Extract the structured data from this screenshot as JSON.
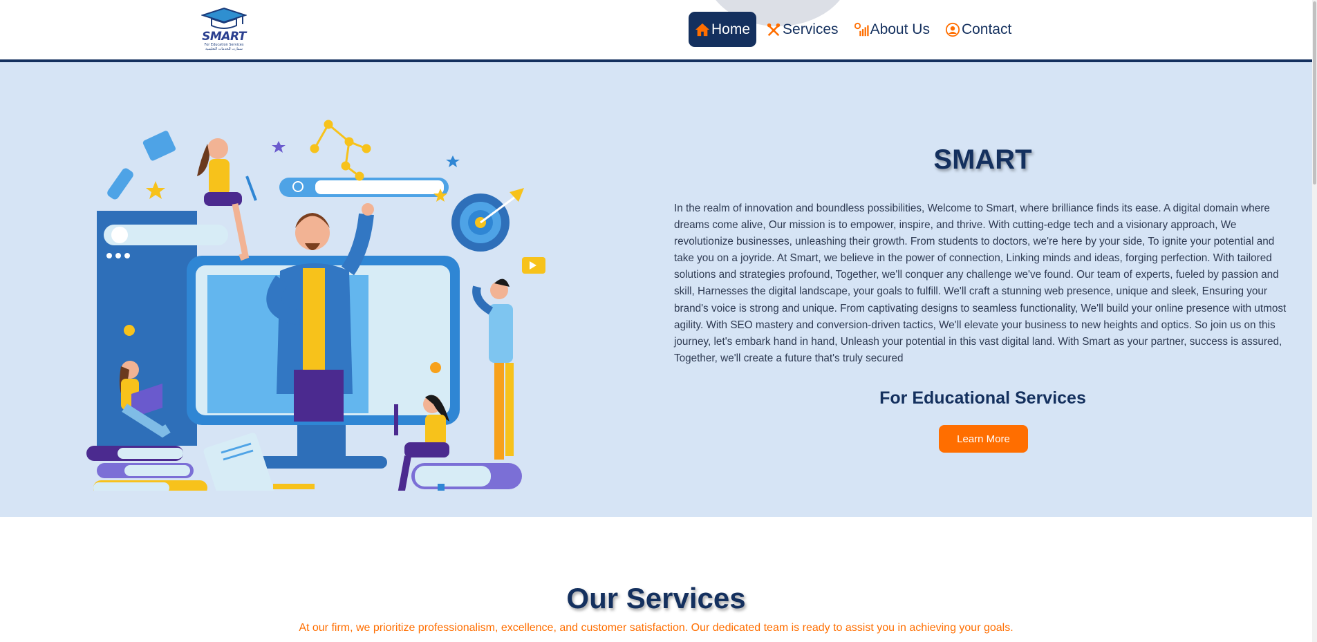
{
  "brand": {
    "logo_text": "SMART",
    "logo_sub_en": "For Education Services",
    "logo_sub_ar": "سمارت للخدمات التعليمية",
    "primary_color": "#14305e",
    "accent_color": "#ff6e00",
    "hero_bg": "#d6e4f5"
  },
  "nav": {
    "items": [
      {
        "label": "Home",
        "icon": "home-icon",
        "active": true
      },
      {
        "label": "Services",
        "icon": "tools-icon",
        "active": false
      },
      {
        "label": "About Us",
        "icon": "chart-icon",
        "active": false
      },
      {
        "label": "Contact",
        "icon": "contact-icon",
        "active": false
      }
    ]
  },
  "hero": {
    "title": "SMART",
    "paragraph": "In the realm of innovation and boundless possibilities, Welcome to Smart, where brilliance finds its ease. A digital domain where dreams come alive, Our mission is to empower, inspire, and thrive. With cutting-edge tech and a visionary approach, We revolutionize businesses, unleashing their growth. From students to doctors, we're here by your side, To ignite your potential and take you on a joyride. At Smart, we believe in the power of connection, Linking minds and ideas, forging perfection. With tailored solutions and strategies profound, Together, we'll conquer any challenge we've found. Our team of experts, fueled by passion and skill, Harnesses the digital landscape, your goals to fulfill. We'll craft a stunning web presence, unique and sleek, Ensuring your brand's voice is strong and unique. From captivating designs to seamless functionality, We'll build your online presence with utmost agility. With SEO mastery and conversion-driven tactics, We'll elevate your business to new heights and optics. So join us on this journey, let's embark hand in hand, Unleash your potential in this vast digital land. With Smart as your partner, success is assured, Together, we'll create a future that's truly secured",
    "subtitle": "For Educational Services",
    "cta_label": "Learn More"
  },
  "services": {
    "title": "Our Services",
    "description": "At our firm, we prioritize professionalism, excellence, and customer satisfaction. Our dedicated team is ready to assist you in achieving your goals."
  }
}
